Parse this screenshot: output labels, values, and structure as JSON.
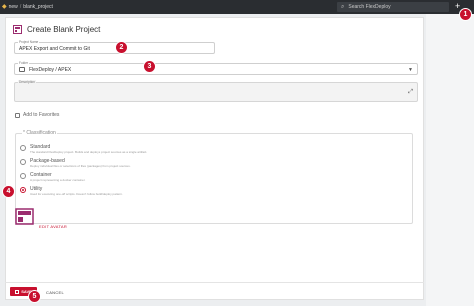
{
  "topbar": {
    "breadcrumb": [
      "new",
      "blank_project"
    ],
    "search_placeholder": "Search FlexDeploy",
    "plus_label": "+"
  },
  "page": {
    "title": "Create Blank Project"
  },
  "form": {
    "project_name": {
      "label": "Project Name",
      "value": "APEX Export and Commit to Git"
    },
    "folder": {
      "label": "Folder",
      "value": "FlexDeploy / APEX"
    },
    "description": {
      "label": "Description",
      "value": ""
    },
    "favorites_label": "Add to Favorites"
  },
  "classification": {
    "label": "* Classification",
    "selected": "Utility",
    "options": [
      {
        "name": "Standard",
        "desc": "The standard FlexDeploy project. Builds and deploys project sources as a single artifact."
      },
      {
        "name": "Package-based",
        "desc": "Deploy individual files or selections of files (packages) from project sources."
      },
      {
        "name": "Container",
        "desc": "A project representing a docker container."
      },
      {
        "name": "Utility",
        "desc": "Used for executing one-off scripts. Doesn't follow build/deploy pattern."
      }
    ]
  },
  "avatar": {
    "edit_label": "EDIT AVATAR"
  },
  "footer": {
    "save_label": "SAVE",
    "cancel_label": "CANCEL"
  },
  "annotations": [
    "1",
    "2",
    "3",
    "4",
    "5"
  ],
  "colors": {
    "accent": "#c8102e",
    "topbar": "#2a2d31",
    "home": "#e8b64a"
  }
}
